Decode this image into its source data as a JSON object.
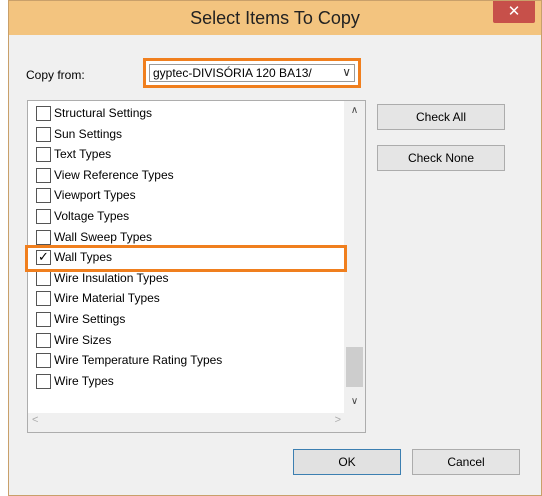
{
  "dialog": {
    "title": "Select Items To Copy",
    "close_label": "✕"
  },
  "copy_from": {
    "label": "Copy from:",
    "value": "gyptec-DIVISÓRIA 120 BA13/",
    "arrow": "∨"
  },
  "items": [
    {
      "label": "Structural Settings",
      "checked": false
    },
    {
      "label": "Sun Settings",
      "checked": false
    },
    {
      "label": "Text Types",
      "checked": false
    },
    {
      "label": "View Reference Types",
      "checked": false
    },
    {
      "label": "Viewport Types",
      "checked": false
    },
    {
      "label": "Voltage Types",
      "checked": false
    },
    {
      "label": "Wall Sweep Types",
      "checked": false
    },
    {
      "label": "Wall Types",
      "checked": true
    },
    {
      "label": "Wire Insulation Types",
      "checked": false
    },
    {
      "label": "Wire Material Types",
      "checked": false
    },
    {
      "label": "Wire Settings",
      "checked": false
    },
    {
      "label": "Wire Sizes",
      "checked": false
    },
    {
      "label": "Wire Temperature Rating Types",
      "checked": false
    },
    {
      "label": "Wire Types",
      "checked": false
    }
  ],
  "check_mark": "✓",
  "scroll": {
    "up": "∧",
    "down": "∨",
    "left": "<",
    "right": ">"
  },
  "buttons": {
    "check_all": "Check All",
    "check_none": "Check None",
    "ok": "OK",
    "cancel": "Cancel"
  },
  "colors": {
    "title_bar": "#f3c47f",
    "close_button": "#c7504a",
    "highlight": "#f07f1e"
  }
}
